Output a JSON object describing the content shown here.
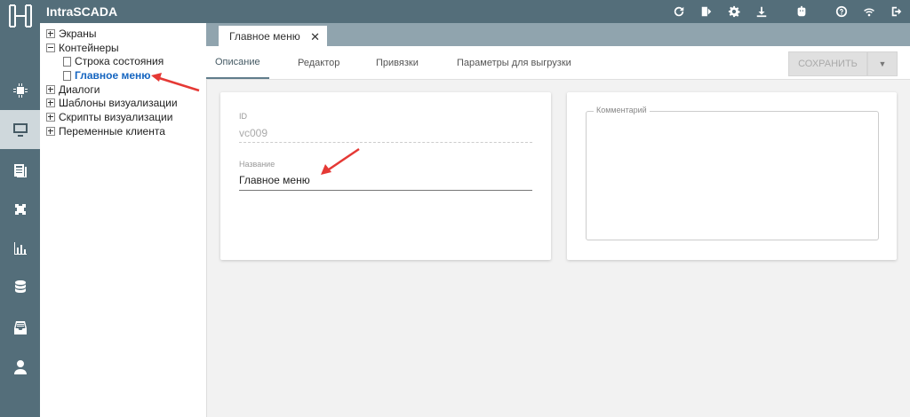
{
  "app": {
    "title": "IntraSCADA"
  },
  "topbar_icons": [
    "refresh-icon",
    "layout-icon",
    "gear-icon",
    "download-icon",
    "robot-icon",
    "help-icon",
    "wifi-icon",
    "logout-icon"
  ],
  "rail": {
    "items": [
      {
        "name": "chip-icon",
        "active": false
      },
      {
        "name": "monitor-icon",
        "active": true
      },
      {
        "name": "document-list-icon",
        "active": false
      },
      {
        "name": "puzzle-icon",
        "active": false
      },
      {
        "name": "bar-chart-icon",
        "active": false
      },
      {
        "name": "database-icon",
        "active": false
      },
      {
        "name": "archive-icon",
        "active": false
      },
      {
        "name": "user-icon",
        "active": false
      }
    ]
  },
  "tree": {
    "items": [
      {
        "label": "Экраны",
        "toggle": "plus"
      },
      {
        "label": "Контейнеры",
        "toggle": "minus"
      },
      {
        "label": "Строка состояния",
        "toggle": "doc"
      },
      {
        "label": "Главное меню",
        "toggle": "doc",
        "selected": true
      },
      {
        "label": "Диалоги",
        "toggle": "plus"
      },
      {
        "label": "Шаблоны визуализации",
        "toggle": "plus"
      },
      {
        "label": "Скрипты визуализации",
        "toggle": "plus"
      },
      {
        "label": "Переменные клиента",
        "toggle": "plus"
      }
    ]
  },
  "tab": {
    "label": "Главное меню",
    "close": "✕"
  },
  "subnav": {
    "tabs": [
      "Описание",
      "Редактор",
      "Привязки",
      "Параметры для выгрузки"
    ],
    "save_label": "СОХРАНИТЬ",
    "save_dropdown": "▼"
  },
  "form": {
    "id_label": "ID",
    "id_value": "vc009",
    "name_label": "Название",
    "name_value": "Главное меню",
    "comment_label": "Комментарий"
  },
  "colors": {
    "accent": "#546e7a",
    "tab_strip": "#90a4ae",
    "selected_text": "#1565c0",
    "annotation": "#e53935"
  }
}
